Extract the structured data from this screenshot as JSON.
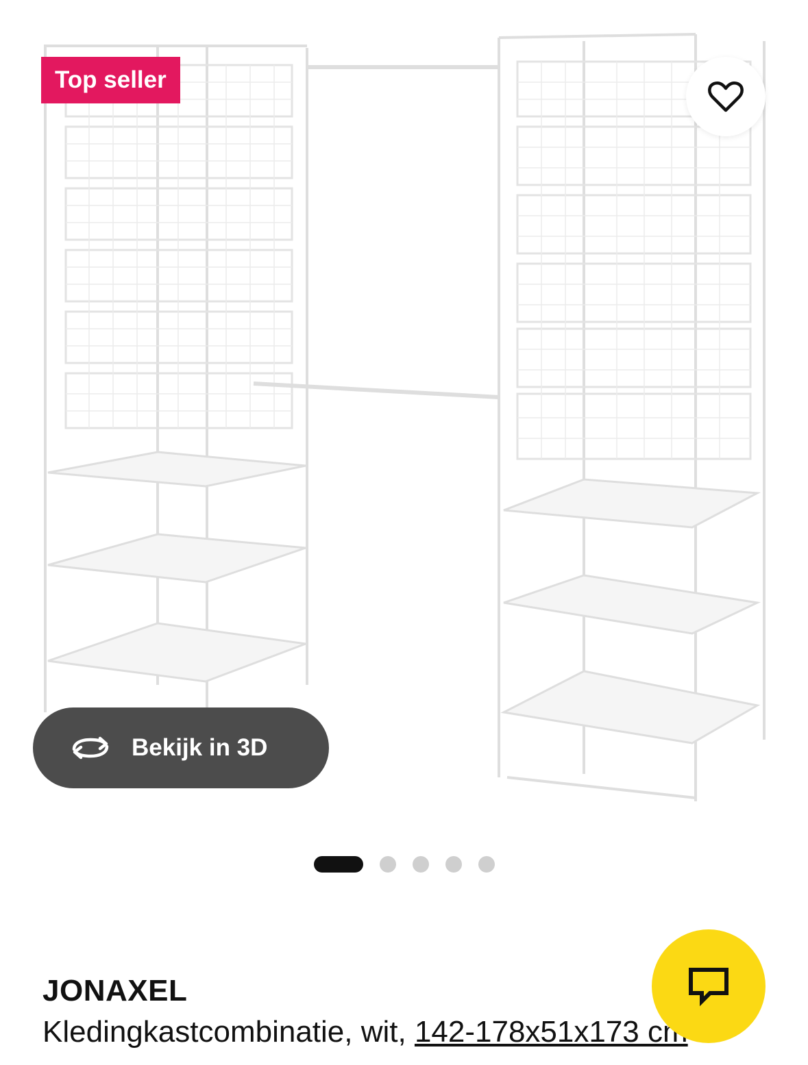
{
  "badge": {
    "label": "Top seller",
    "color": "#e3185f"
  },
  "favorite": {
    "icon": "heart-icon"
  },
  "view3d": {
    "label": "Bekijk in 3D",
    "icon": "rotate-3d-icon"
  },
  "carousel": {
    "total": 5,
    "active_index": 0
  },
  "product": {
    "name": "JONAXEL",
    "description_prefix": "Kledingkastcombinatie, wit, ",
    "size_text": "142-178x51x173 cm"
  },
  "chat": {
    "icon": "chat-bubble-icon",
    "color": "#fbd914"
  }
}
